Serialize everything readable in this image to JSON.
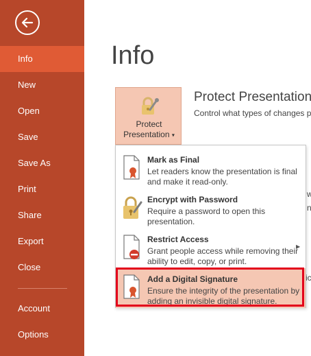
{
  "sidebar": {
    "items": [
      {
        "label": "Info",
        "active": true
      },
      {
        "label": "New"
      },
      {
        "label": "Open"
      },
      {
        "label": "Save"
      },
      {
        "label": "Save As"
      },
      {
        "label": "Print"
      },
      {
        "label": "Share"
      },
      {
        "label": "Export"
      },
      {
        "label": "Close"
      },
      {
        "label": "Account"
      },
      {
        "label": "Options"
      }
    ]
  },
  "main": {
    "title": "Info",
    "protect_button": {
      "line1": "Protect",
      "line2": "Presentation",
      "caret": "▾"
    },
    "section_heading": "Protect Presentation",
    "section_desc": "Control what types of changes p",
    "behind_fragments": [
      "w",
      "n",
      "",
      "ic"
    ]
  },
  "menu": {
    "items": [
      {
        "title": "Mark as Final",
        "desc": "Let readers know the presentation is final and make it read-only."
      },
      {
        "title": "Encrypt with Password",
        "desc": "Require a password to open this presentation."
      },
      {
        "title": "Restrict Access",
        "desc": "Grant people access while removing their ability to edit, copy, or print.",
        "submenu_arrow": "▶"
      },
      {
        "title": "Add a Digital Signature",
        "desc": "Ensure the integrity of the presentation by adding an invisible digital signature.",
        "highlighted": true
      }
    ]
  },
  "colors": {
    "sidebar": "#b7472a",
    "active_nav": "#e05b35",
    "highlight_fill": "#f5c7b3",
    "callout_border": "#e3001b"
  }
}
